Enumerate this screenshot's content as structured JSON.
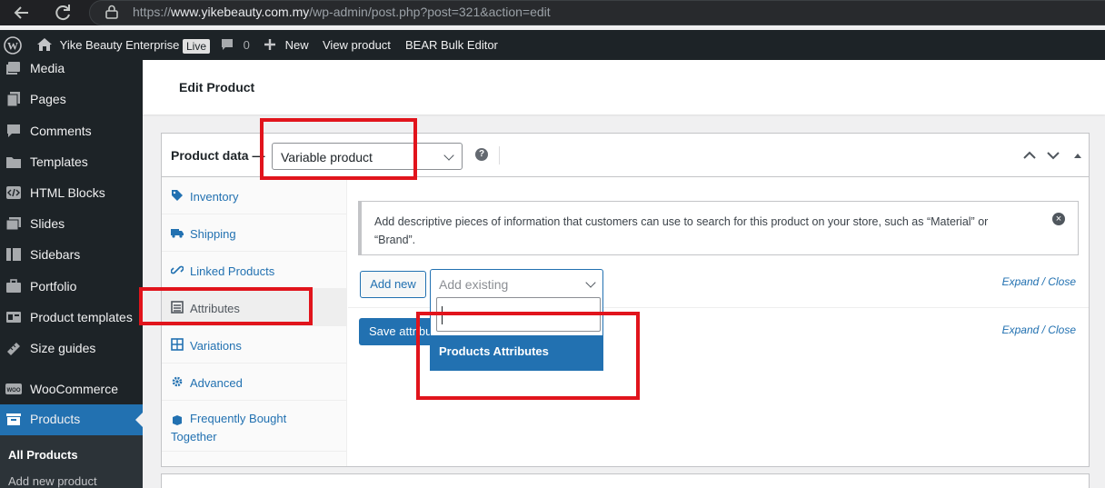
{
  "browser": {
    "url_prefix": "https://",
    "url_domain": "www.yikebeauty.com.my",
    "url_path": "/wp-admin/post.php?post=321&action=edit"
  },
  "adminbar": {
    "site_name": "Yike Beauty Enterprise",
    "live_badge": "Live",
    "comments_count": "0",
    "new_label": "New",
    "view_product": "View product",
    "bulk_editor": "BEAR Bulk Editor"
  },
  "sidebar": {
    "items": [
      {
        "label": "Media",
        "icon": "media-icon"
      },
      {
        "label": "Pages",
        "icon": "pages-icon"
      },
      {
        "label": "Comments",
        "icon": "comments-icon"
      },
      {
        "label": "Templates",
        "icon": "templates-icon"
      },
      {
        "label": "HTML Blocks",
        "icon": "html-blocks-icon"
      },
      {
        "label": "Slides",
        "icon": "slides-icon"
      },
      {
        "label": "Sidebars",
        "icon": "sidebars-icon"
      },
      {
        "label": "Portfolio",
        "icon": "portfolio-icon"
      },
      {
        "label": "Product templates",
        "icon": "product-templates-icon"
      },
      {
        "label": "Size guides",
        "icon": "size-guides-icon"
      },
      {
        "label": "WooCommerce",
        "icon": "woocommerce-icon"
      },
      {
        "label": "Products",
        "icon": "products-icon"
      }
    ],
    "submenu": [
      "All Products",
      "Add new product"
    ]
  },
  "page": {
    "title": "Edit Product"
  },
  "product_data": {
    "title": "Product data —",
    "type_value": "Variable product",
    "help": "?",
    "tabs": [
      {
        "label": "Inventory",
        "icon": "inventory-tag-icon"
      },
      {
        "label": "Shipping",
        "icon": "shipping-truck-icon"
      },
      {
        "label": "Linked Products",
        "icon": "link-icon"
      },
      {
        "label": "Attributes",
        "icon": "attributes-list-icon"
      },
      {
        "label": "Variations",
        "icon": "variations-grid-icon"
      },
      {
        "label": "Advanced",
        "icon": "gear-icon"
      },
      {
        "label": "Frequently Bought Together",
        "icon": "box-icon"
      }
    ],
    "notice": "Add descriptive pieces of information that customers can use to search for this product on your store, such as “Material” or “Brand”.",
    "add_new": "Add new",
    "add_existing_placeholder": "Add existing",
    "expand_close": "Expand / Close",
    "save_attributes": "Save attributes",
    "dropdown_option": "Products Attributes"
  },
  "colors": {
    "highlight": "#e1141c",
    "accent": "#2271b1",
    "admin_dark": "#1d2327"
  }
}
